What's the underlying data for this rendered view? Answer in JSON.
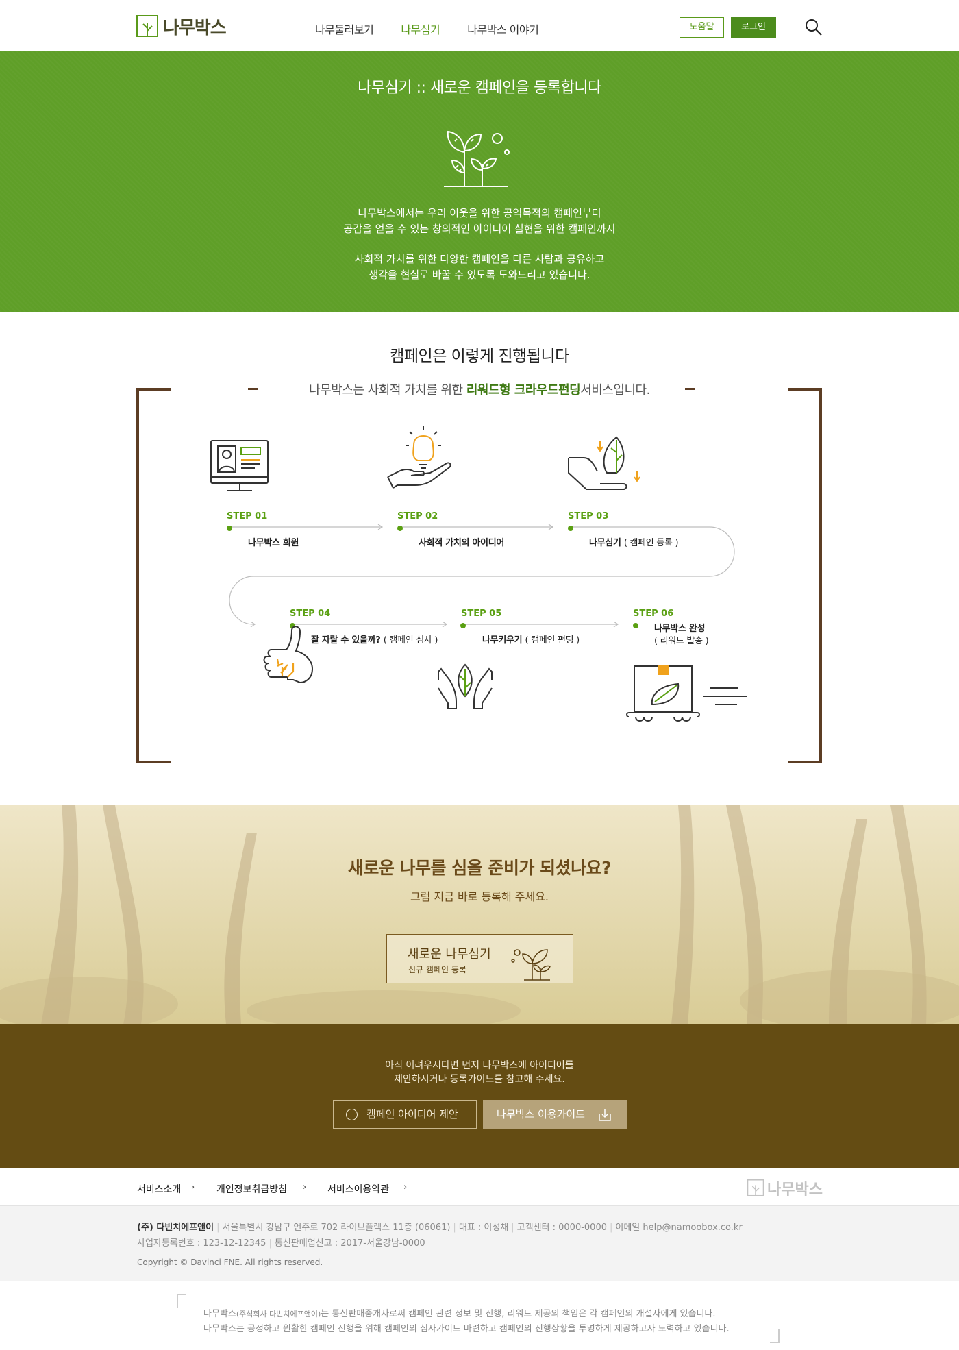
{
  "header": {
    "logo_text": "나무박스",
    "nav": [
      {
        "label": "나무둘러보기",
        "active": false
      },
      {
        "label": "나무심기",
        "active": true
      },
      {
        "label": "나무박스 이야기",
        "active": false
      }
    ],
    "help_label": "도움말",
    "login_label": "로그인"
  },
  "hero": {
    "title": "나무심기  ::  새로운 캠페인을 등록합니다",
    "desc1_line1": "나무박스에서는 우리 이웃을 위한 공익목적의 캠페인부터",
    "desc1_line2": "공감을 얻을 수 있는 창의적인 아이디어 실현을 위한 캠페인까지",
    "desc2_line1": "사회적 가치를 위한 다양한 캠페인을 다른 사람과 공유하고",
    "desc2_line2": "생각을 현실로 바꿀 수 있도록 도와드리고 있습니다."
  },
  "process": {
    "title": "캠페인은 이렇게 진행됩니다",
    "subtitle_pre": "나무박스는 사회적 가치를 위한 ",
    "subtitle_highlight": "리워드형 크라우드펀딩",
    "subtitle_post": "서비스입니다.",
    "steps": [
      {
        "label": "STEP 01",
        "desc": "나무박스 회원",
        "note": ""
      },
      {
        "label": "STEP 02",
        "desc": "사회적 가치의 아이디어",
        "note": ""
      },
      {
        "label": "STEP 03",
        "desc": "나무심기",
        "note": "( 캠페인 등록 )"
      },
      {
        "label": "STEP 04",
        "desc": "잘 자랄 수 있을까?",
        "note": "( 캠페인 심사 )"
      },
      {
        "label": "STEP 05",
        "desc": "나무키우기",
        "note": "( 캠페인 펀딩 )"
      },
      {
        "label": "STEP 06",
        "desc": "나무박스 완성",
        "note": "( 리워드 발송 )"
      }
    ]
  },
  "cta": {
    "title": "새로운 나무를 심을 준비가 되셨나요?",
    "subtitle": "그럼 지금 바로 등록해 주세요.",
    "button_title": "새로운 나무심기",
    "button_sub": "신규 캠페인 등록"
  },
  "guide": {
    "line1": "아직 어려우시다면 먼저 나무박스에 아이디어를",
    "line2": "제안하시거나 등록가이드를 참고해 주세요.",
    "idea_button": "캠페인 아이디어 제안",
    "guide_button": "나무박스 이용가이드"
  },
  "footer": {
    "links": [
      "서비스소개",
      "개인정보취급방침",
      "서비스이용약관"
    ],
    "logo_text": "나무박스",
    "company": "(주) 다빈치에프앤이",
    "address": "서울특별시 강남구 언주로 702 라이브플렉스 11층 (06061)",
    "ceo": "대표 : 이성채",
    "service_center": "고객센터 : 0000-0000",
    "email": "이메일 help@namoobox.co.kr",
    "biz_no": "사업자등록번호 : 123-12-12345",
    "mail_order": "통신판매업신고 : 2017-서울강남-0000",
    "copyright": "Copyright © Davinci FNE. All rights reserved.",
    "notice_line1_a": "나무박스",
    "notice_line1_small": "(주식회사 다빈치에프앤이)",
    "notice_line1_b": "는 통신판매중개자로써 캠페인 관련 정보 및 진행, 리워드 제공의 책임은 각 캠페인의 개설자에게 있습니다.",
    "notice_line2": "나무박스는 공정하고 원활한 캠페인 진행을 위해 캠페인의 심사가이드 마련하고 캠페인의 진행상황을 투명하게 제공하고자 노력하고 있습니다."
  },
  "colors": {
    "primary_green": "#5f9f28",
    "step_green": "#5aa012",
    "brown": "#644c13",
    "bracket_brown": "#5c3d24"
  }
}
